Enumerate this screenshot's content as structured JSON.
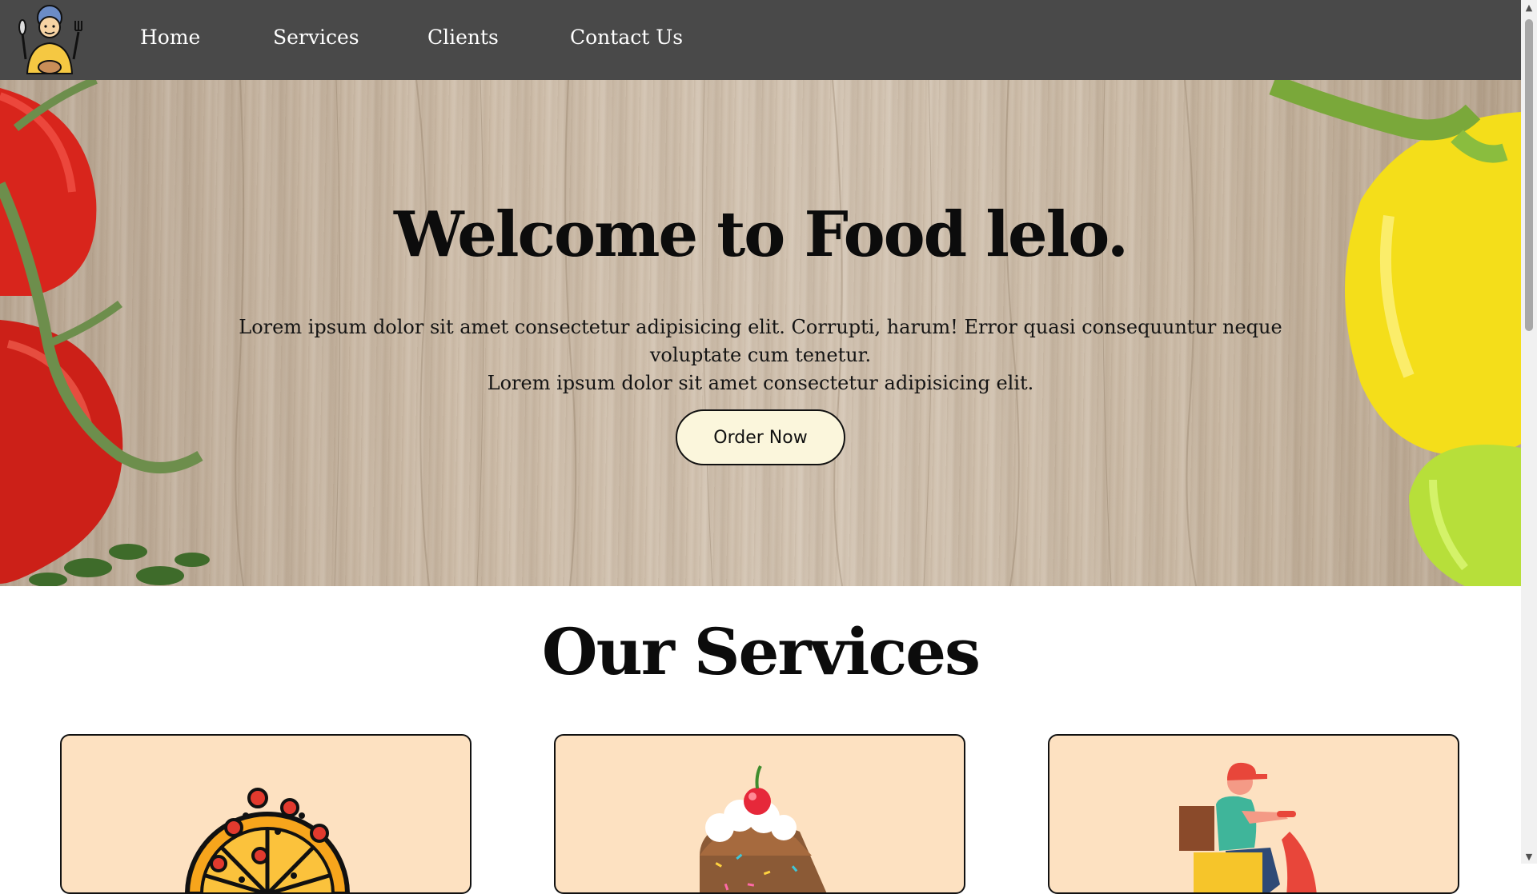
{
  "nav": {
    "logo_icon": "chef-logo-icon",
    "links": [
      {
        "label": "Home"
      },
      {
        "label": "Services"
      },
      {
        "label": "Clients"
      },
      {
        "label": "Contact Us"
      }
    ]
  },
  "hero": {
    "title": "Welcome to Food lelo.",
    "paragraph_line1": "Lorem ipsum dolor sit amet consectetur adipisicing elit. Corrupti, harum! Error quasi consequuntur neque voluptate cum tenetur.",
    "paragraph_line2": "Lorem ipsum dolor sit amet consectetur adipisicing elit.",
    "button_label": "Order Now",
    "background": "wood-table-with-vegetables"
  },
  "services": {
    "title": "Our Services",
    "cards": [
      {
        "icon": "pizza-icon"
      },
      {
        "icon": "cake-slice-icon"
      },
      {
        "icon": "delivery-scooter-icon"
      }
    ]
  },
  "colors": {
    "navbar": "#494949",
    "card_bg": "#fde1c1",
    "button_bg": "#fbf6dc"
  }
}
